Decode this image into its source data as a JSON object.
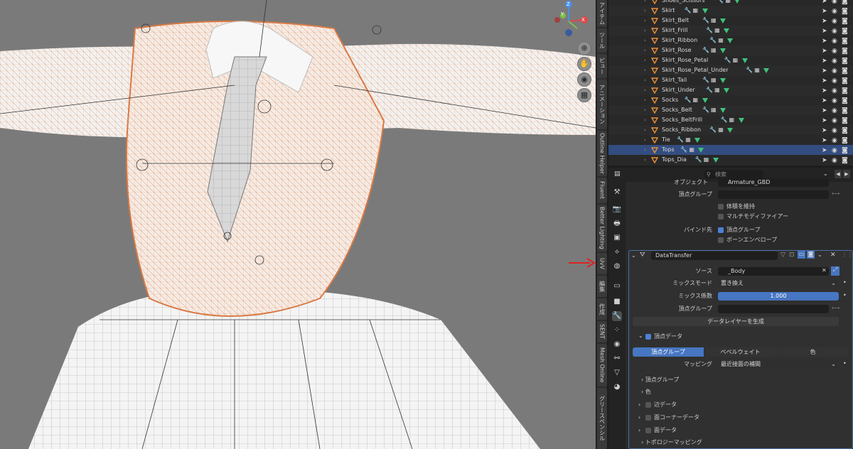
{
  "viewport": {
    "gizmo": {
      "x": "X",
      "y": "Y",
      "z": "Z"
    },
    "colors": {
      "bg": "#7a7a7a",
      "wire": "#e8a074",
      "mesh": "#eeeeee"
    }
  },
  "n_panel_tabs": [
    "アイテム",
    "ツール",
    "ビュー",
    "アニメーション",
    "Outline Helper",
    "Fluent",
    "Better Lighting",
    "UvV",
    "編集",
    "作成",
    "SENT",
    "Mesh Online",
    "グリースペンシル"
  ],
  "outliner": {
    "rows": [
      {
        "name": "Shoes_Scissors",
        "selected": false
      },
      {
        "name": "Skirt",
        "selected": false
      },
      {
        "name": "Skirt_Belt",
        "selected": false
      },
      {
        "name": "Skirt_Frill",
        "selected": false
      },
      {
        "name": "Skirt_Ribbon",
        "selected": false
      },
      {
        "name": "Skirt_Rose",
        "selected": false
      },
      {
        "name": "Skirt_Rose_Petal",
        "selected": false
      },
      {
        "name": "Skirt_Rose_Petal_Under",
        "selected": false
      },
      {
        "name": "Skirt_Tail",
        "selected": false
      },
      {
        "name": "Skirt_Under",
        "selected": false
      },
      {
        "name": "Socks",
        "selected": false
      },
      {
        "name": "Socks_Belt",
        "selected": false
      },
      {
        "name": "Socks_BeltFrill",
        "selected": false
      },
      {
        "name": "Socks_Ribbon",
        "selected": false
      },
      {
        "name": "Tie",
        "selected": false
      },
      {
        "name": "Tops",
        "selected": true
      },
      {
        "name": "Tops_Dia",
        "selected": false
      }
    ]
  },
  "properties": {
    "search_placeholder": "検索",
    "armature_section": {
      "object_label": "オブジェクト",
      "object_value": "Armature_GBD",
      "vertex_group_label": "頂点グループ",
      "preserve_volume": "体積を維持",
      "multi_modifier": "マルチモディファイアー",
      "bind_to_label": "バインド先",
      "bind_vertex_groups": "頂点グループ",
      "bind_bone_envelopes": "ボーンエンベロープ"
    },
    "data_transfer": {
      "name": "DataTransfer",
      "source_label": "ソース",
      "source_value": "_Body",
      "mix_mode_label": "ミックスモード",
      "mix_mode_value": "置き換え",
      "mix_factor_label": "ミックス係数",
      "mix_factor_value": "1.000",
      "mix_factor": 1.0,
      "vertex_group_label": "頂点グループ",
      "generate_layers": "データレイヤーを生成",
      "vertex_data": "頂点データ",
      "tabs": [
        "頂点グループ",
        "ベベルウェイト",
        "色"
      ],
      "active_tab": 0,
      "mapping_label": "マッピング",
      "mapping_value": "最近接面の補間",
      "subpanels": [
        "頂点グループ",
        "色"
      ],
      "edge_data": "辺データ",
      "face_corner_data": "面コーナーデータ",
      "face_data": "面データ",
      "topology_mapping": "トポロジーマッピング"
    }
  }
}
